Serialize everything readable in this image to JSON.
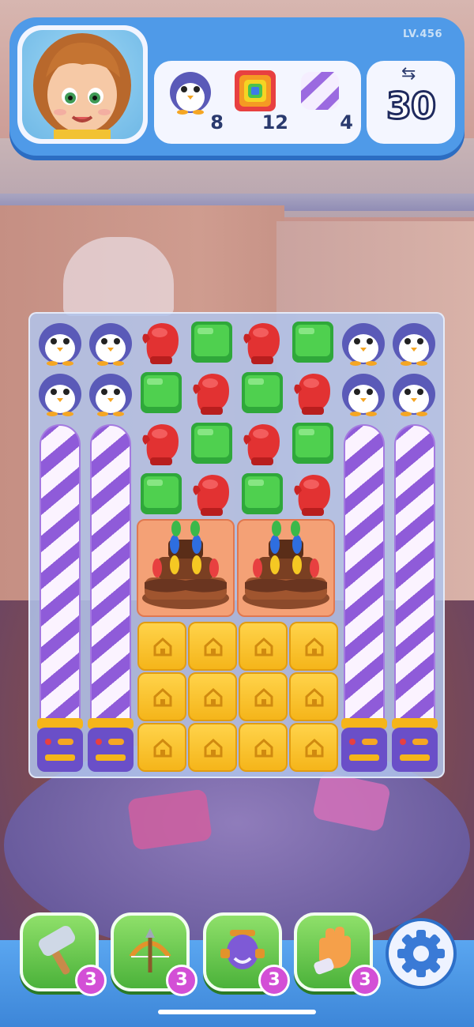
{
  "hud": {
    "level": "LV.456",
    "moves_icon": "swap-arrows-icon",
    "moves": "30",
    "goals": [
      {
        "icon": "penguin-icon",
        "count": "8"
      },
      {
        "icon": "rainbow-box-icon",
        "count": "12"
      },
      {
        "icon": "striped-candy-icon",
        "count": "4"
      }
    ]
  },
  "board": {
    "rows_top": [
      [
        "penguin",
        "penguin",
        "glove",
        "green-block",
        "glove",
        "green-block",
        "penguin",
        "penguin"
      ],
      [
        "penguin",
        "penguin",
        "green-block",
        "glove",
        "green-block",
        "glove",
        "penguin",
        "penguin"
      ]
    ],
    "center_rows": [
      [
        "glove",
        "green-block",
        "glove",
        "green-block"
      ],
      [
        "green-block",
        "glove",
        "green-block",
        "glove"
      ]
    ],
    "poles": [
      "striped-pole",
      "striped-pole",
      "striped-pole",
      "striped-pole"
    ],
    "cakes": [
      "cake",
      "cake"
    ],
    "crates": "crate-icon"
  },
  "boosters": [
    {
      "name": "hammer",
      "icon": "hammer-icon",
      "count": "3"
    },
    {
      "name": "crossbow",
      "icon": "crossbow-icon",
      "count": "3"
    },
    {
      "name": "cannon",
      "icon": "cannon-icon",
      "count": "3"
    },
    {
      "name": "glove",
      "icon": "glove-icon",
      "count": "3"
    }
  ],
  "settings": {
    "icon": "gear-icon"
  },
  "colors": {
    "hud_blue": "#4f9ae8",
    "booster_green": "#4bb23a",
    "badge_purple": "#d34fd6"
  }
}
